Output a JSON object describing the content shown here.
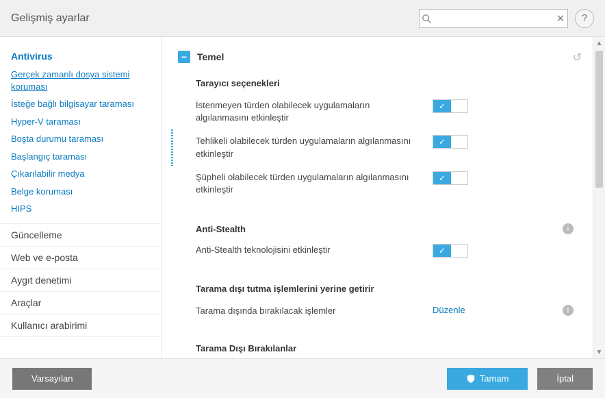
{
  "header": {
    "title": "Gelişmiş ayarlar",
    "search_placeholder": "",
    "help_label": "?"
  },
  "sidebar": {
    "active": "Antivirus",
    "subs": [
      "Gerçek zamanlı dosya sistemi koruması",
      "İsteğe bağlı bilgisayar taraması",
      "Hyper-V taraması",
      "Boşta durumu taraması",
      "Başlangıç taraması",
      "Çıkarılabilir medya",
      "Belge koruması",
      "HIPS"
    ],
    "cats": [
      "Güncelleme",
      "Web ve e-posta",
      "Aygıt denetimi",
      "Araçlar",
      "Kullanıcı arabirimi"
    ]
  },
  "content": {
    "section_title": "Temel",
    "groups": [
      {
        "title": "Tarayıcı seçenekleri",
        "rows": [
          {
            "label": "İstenmeyen türden olabilecek uygulamaların algılanmasını etkinleştir",
            "toggle": true
          },
          {
            "label": "Tehlikeli olabilecek türden uygulamaların algılanmasını etkinleştir",
            "toggle": true,
            "modified": true
          },
          {
            "label": "Şüpheli olabilecek türden uygulamaların algılanmasını etkinleştir",
            "toggle": true
          }
        ]
      },
      {
        "title": "Anti-Stealth",
        "info": true,
        "rows": [
          {
            "label": "Anti-Stealth teknolojisini etkinleştir",
            "toggle": true
          }
        ]
      },
      {
        "title": "Tarama dışı tutma işlemlerini yerine getirir",
        "rows": [
          {
            "label": "Tarama dışında bırakılacak işlemler",
            "link": "Düzenle",
            "info": true
          }
        ]
      },
      {
        "title": "Tarama Dışı Bırakılanlar"
      }
    ]
  },
  "footer": {
    "default": "Varsayılan",
    "ok": "Tamam",
    "cancel": "İptal"
  }
}
